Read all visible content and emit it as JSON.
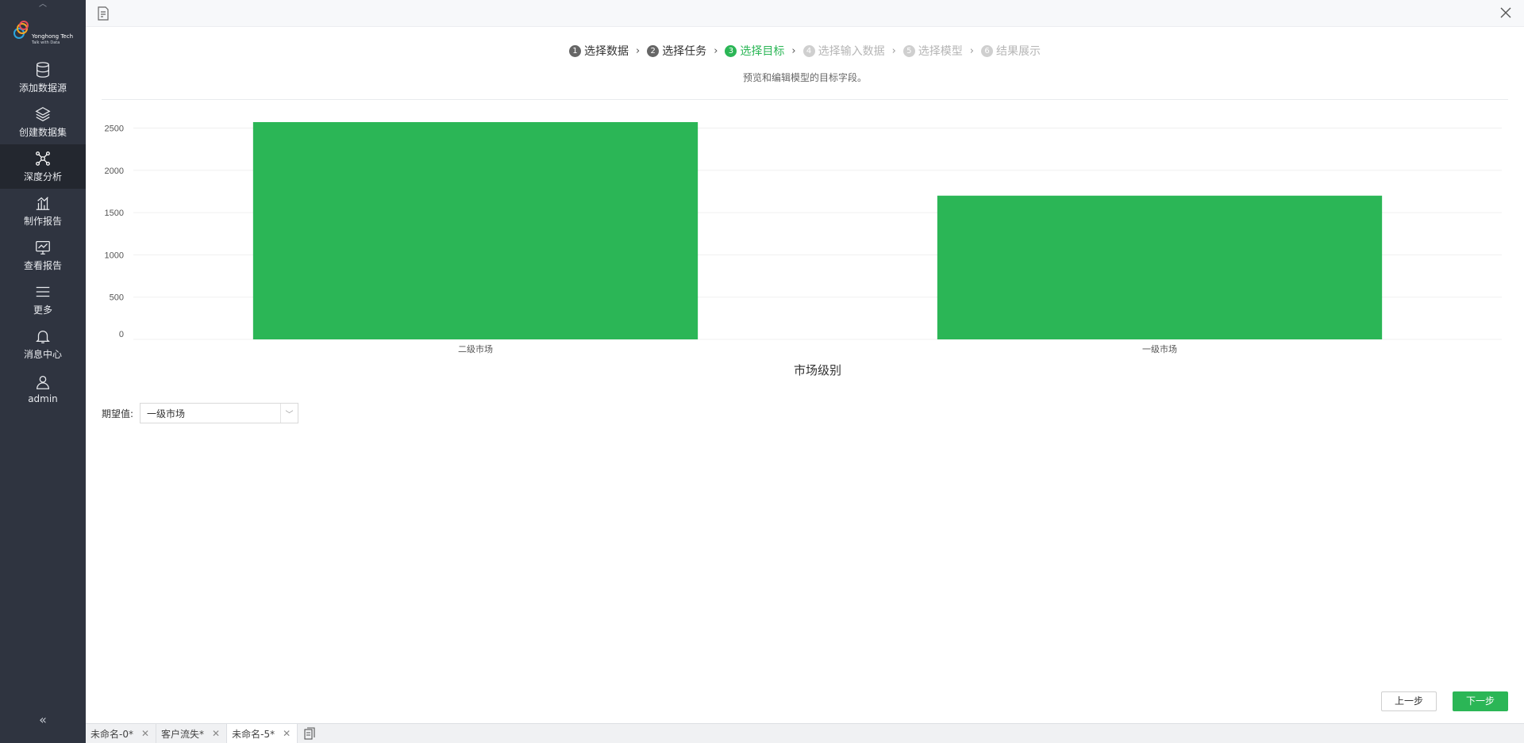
{
  "sidebar": {
    "logo": {
      "name": "Yonghong Tech",
      "tagline": "Talk with Data"
    },
    "items": [
      {
        "label": "添加数据源",
        "icon": "database-icon"
      },
      {
        "label": "创建数据集",
        "icon": "layers-icon"
      },
      {
        "label": "深度分析",
        "icon": "analysis-network-icon",
        "active": true
      },
      {
        "label": "制作报告",
        "icon": "bar-chart-icon"
      },
      {
        "label": "查看报告",
        "icon": "monitor-chart-icon"
      },
      {
        "label": "更多",
        "icon": "menu-icon"
      },
      {
        "label": "消息中心",
        "icon": "bell-icon"
      },
      {
        "label": "admin",
        "icon": "user-icon"
      }
    ]
  },
  "steps": [
    {
      "num": "1",
      "label": "选择数据",
      "state": "done"
    },
    {
      "num": "2",
      "label": "选择任务",
      "state": "done"
    },
    {
      "num": "3",
      "label": "选择目标",
      "state": "active"
    },
    {
      "num": "4",
      "label": "选择输入数据",
      "state": "pending"
    },
    {
      "num": "5",
      "label": "选择模型",
      "state": "pending"
    },
    {
      "num": "6",
      "label": "结果展示",
      "state": "pending"
    }
  ],
  "description": "预览和编辑模型的目标字段。",
  "chart_data": {
    "type": "bar",
    "categories": [
      "二级市场",
      "一级市场"
    ],
    "values": [
      2570,
      1700
    ],
    "xlabel": "市场级别",
    "ylabel": "",
    "ylim": [
      0,
      2500
    ],
    "yticks": [
      0,
      500,
      1000,
      1500,
      2000,
      2500
    ],
    "color": "#2bb656",
    "grid": true
  },
  "expected": {
    "label": "期望值:",
    "value": "一级市场"
  },
  "buttons": {
    "prev": "上一步",
    "next": "下一步"
  },
  "tabs": [
    {
      "label": "未命名-0*",
      "active": false
    },
    {
      "label": "客户流失*",
      "active": false
    },
    {
      "label": "未命名-5*",
      "active": true
    }
  ]
}
